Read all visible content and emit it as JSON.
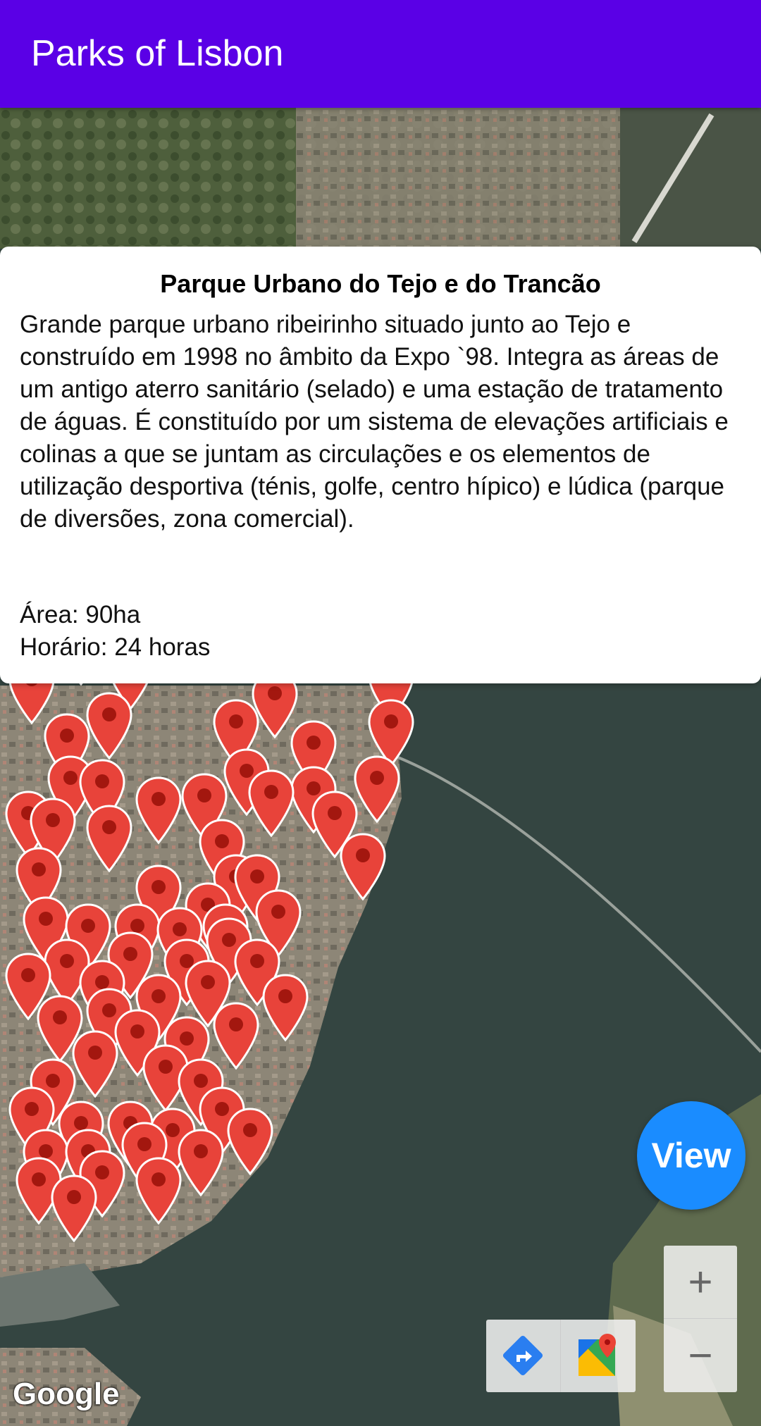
{
  "app": {
    "title": "Parks of Lisbon"
  },
  "info": {
    "title": "Parque Urbano do Tejo e do Trancão",
    "description": "Grande parque urbano ribeirinho situado junto ao Tejo e construído em 1998 no âmbito da Expo `98. Integra as áreas de um antigo aterro sanitário (selado) e uma estação de tratamento de águas. É constituído por um sistema de elevações artificiais e colinas a que se juntam as circulações e os elementos de utilização desportiva (ténis, golfe, centro hípico) e lúdica (parque de diversões, zona comercial).",
    "area": "Área: 90ha",
    "hours": "Horário: 24 horas"
  },
  "fab": {
    "label": "View"
  },
  "map_controls": {
    "zoom_in_symbol": "+",
    "zoom_out_symbol": "−",
    "directions_icon": "directions-icon",
    "open_maps_icon": "google-maps-icon",
    "attribution": "Google"
  },
  "colors": {
    "appbar": "#5a00e6",
    "fab": "#1a8cff",
    "pin": "#e8433a"
  }
}
